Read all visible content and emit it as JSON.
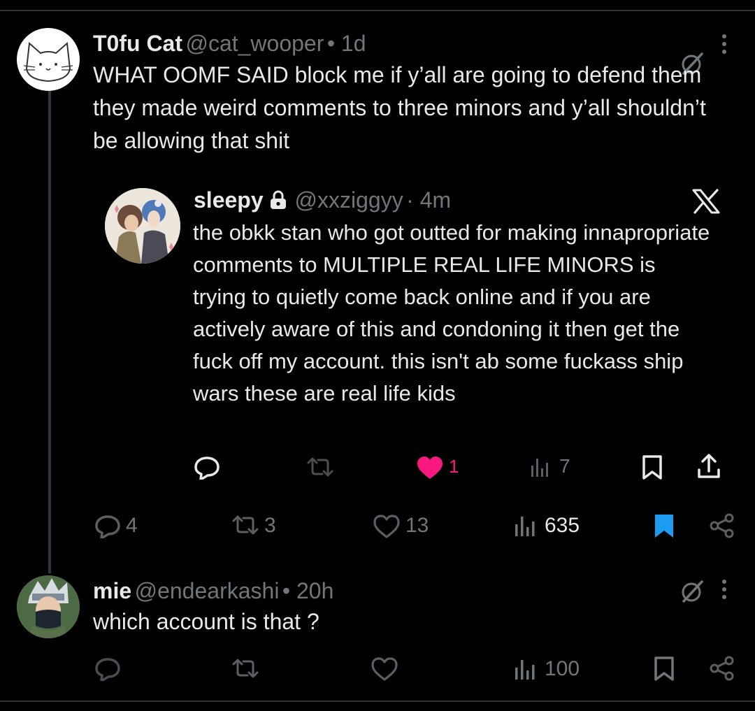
{
  "post": {
    "author_name": "T0fu Cat",
    "handle": "@cat_wooper",
    "time": "• 1d",
    "text": "WHAT OOMF SAID block me if y’all are going to defend them they made weird comments to three minors and y’all shouldn’t be allowing that shit",
    "quote": {
      "author_name": "sleepy",
      "handle": "@xxziggyy",
      "time": "· 4m",
      "platform_logo": "X",
      "text": "the obkk stan who got outted for making innapropriate comments to MULTIPLE REAL LIFE MINORS is trying to quietly come back online and if you are actively aware of this and condoning it then get the fuck off my account. this isn't ab some fuckass ship wars these are real life kids",
      "actions": {
        "likes": "1",
        "views": "7"
      },
      "like_color": "#f91880"
    },
    "actions": {
      "replies": "4",
      "reposts": "3",
      "likes": "13",
      "views": "635"
    },
    "bookmark_color": "#1d9bf0"
  },
  "reply": {
    "author_name": "mie",
    "handle": "@endearkashi",
    "time": "• 20h",
    "text": "which account is that ?",
    "actions": {
      "views": "100"
    }
  },
  "colors": {
    "background": "#000000",
    "text": "#e7e9ea",
    "muted": "#71767b",
    "divider": "#2f3336"
  }
}
